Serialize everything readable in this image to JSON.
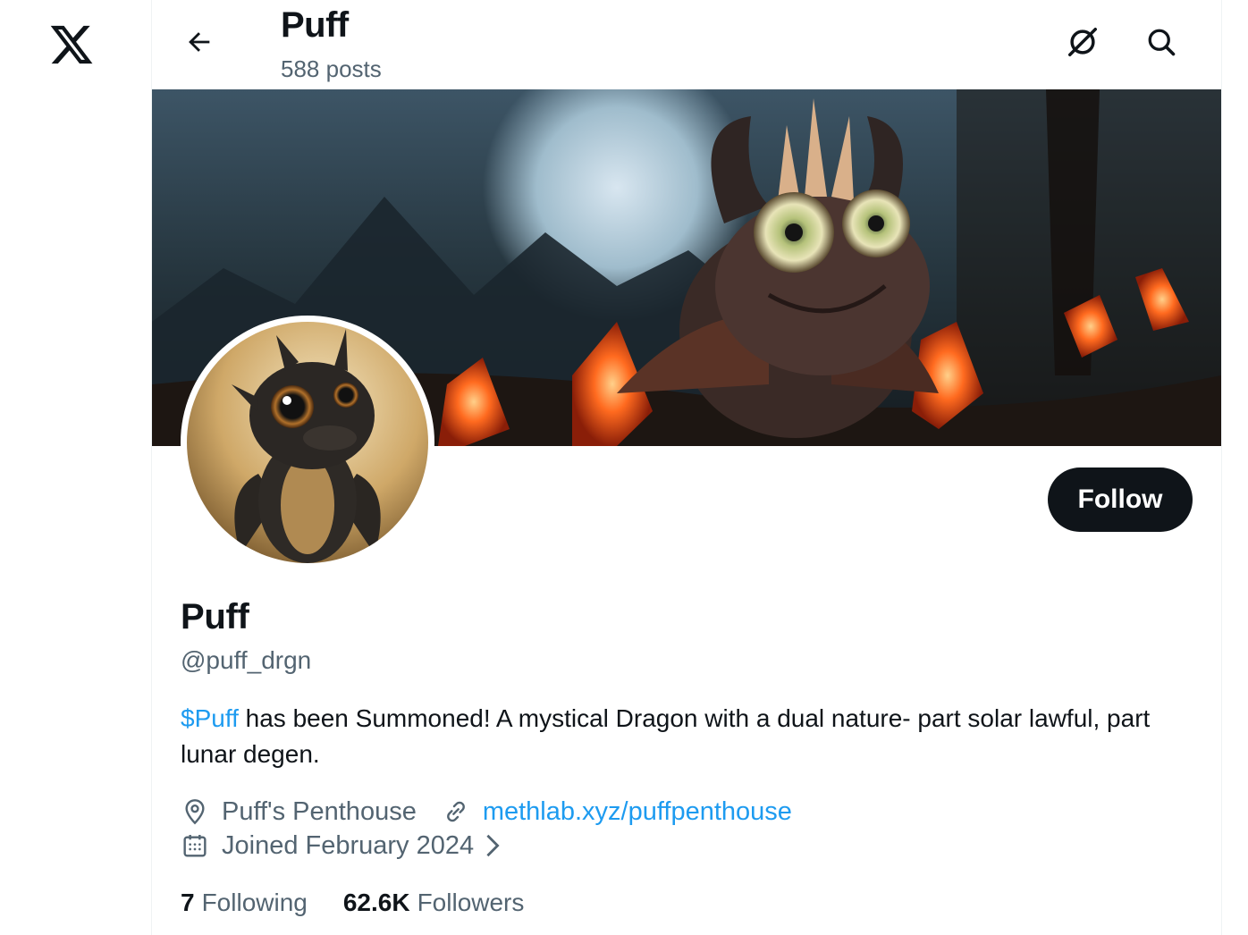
{
  "colors": {
    "accent": "#1d9bf0",
    "text": "#0f1419",
    "muted": "#536471",
    "button_bg": "#0f1419"
  },
  "nav": {
    "logo_icon": "x-logo-icon"
  },
  "topbar": {
    "back_icon": "arrow-left-icon",
    "title": "Puff",
    "post_count": "588 posts",
    "grok_icon": "grok-icon",
    "search_icon": "search-icon"
  },
  "banner": {
    "description_icon": "banner-image"
  },
  "profile": {
    "follow_label": "Follow",
    "display_name": "Puff",
    "handle": "@puff_drgn",
    "bio_cashtag": "$Puff",
    "bio_text": " has been Summoned! A mystical Dragon with a dual nature- part solar lawful, part lunar degen.",
    "location": "Puff's Penthouse",
    "website": "methlab.xyz/puffpenthouse",
    "joined": "Joined February 2024",
    "following_count": "7",
    "following_label": "Following",
    "followers_count": "62.6K",
    "followers_label": "Followers"
  }
}
